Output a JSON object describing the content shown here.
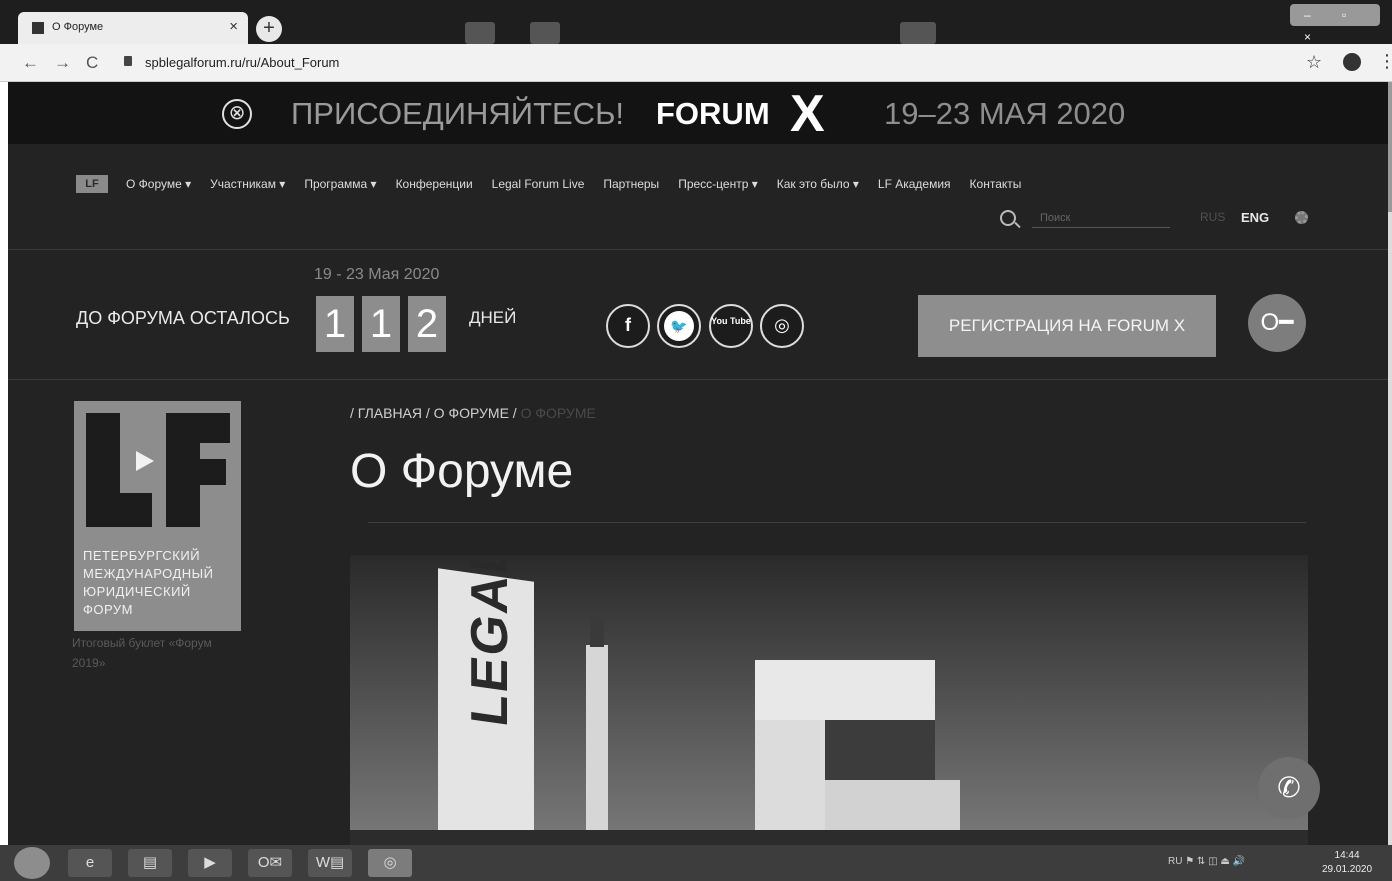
{
  "browser": {
    "tab_title": "О Форуме",
    "tab_close": "×",
    "new_tab": "+",
    "window_controls": "–  ▫  ×",
    "url": "spblegalforum.ru/ru/About_Forum",
    "nav": {
      "back": "←",
      "forward": "→",
      "reload": "C"
    },
    "star": "☆",
    "menu": "⋮"
  },
  "banner": {
    "close": "⊗",
    "join": "ПРИСОЕДИНЯЙТЕСЬ!",
    "forum": "FORUM",
    "x": "X",
    "dates": "19–23 МАЯ 2020"
  },
  "nav": {
    "logo": "LF",
    "items": [
      "О Форуме ▾",
      "Участникам ▾",
      "Программа ▾",
      "Конференции",
      "Legal Forum Live",
      "Партнеры",
      "Пресс-центр ▾",
      "Как это было ▾",
      "LF Академия",
      "Контакты"
    ],
    "search_placeholder": "Поиск",
    "lang_rus": "RUS",
    "lang_eng": "ENG"
  },
  "countdown": {
    "dates": "19 - 23 Мая 2020",
    "label": "ДО ФОРУМА ОСТАЛОСЬ",
    "digits": [
      "1",
      "1",
      "2"
    ],
    "unit": "ДНЕЙ",
    "social": [
      "f",
      "🐦",
      "You Tube",
      "◎"
    ],
    "register": "РЕГИСТРАЦИЯ НА FORUM X",
    "key": "O━"
  },
  "sidebar": {
    "logo_text": "ПЕТЕРБУРГСКИЙ МЕЖДУНАРОДНЫЙ ЮРИДИЧЕСКИЙ ФОРУМ",
    "booklet": "Итоговый буклет «Форум 2019»"
  },
  "content": {
    "breadcrumb_home": "/ ГЛАВНАЯ /",
    "breadcrumb_section": "О ФОРУМЕ /",
    "breadcrumb_current": "О ФОРУМЕ",
    "title": "О Форуме",
    "photo_sign": "LEGAL"
  },
  "call_button": "✆",
  "taskbar": {
    "apps": [
      "e",
      "▤",
      "▶",
      "O✉",
      "W▤",
      "◎"
    ],
    "tray": "RU   ⚑  ⇅  ◫  ⏏  🔊",
    "time": "14:44",
    "date": "29.01.2020"
  }
}
